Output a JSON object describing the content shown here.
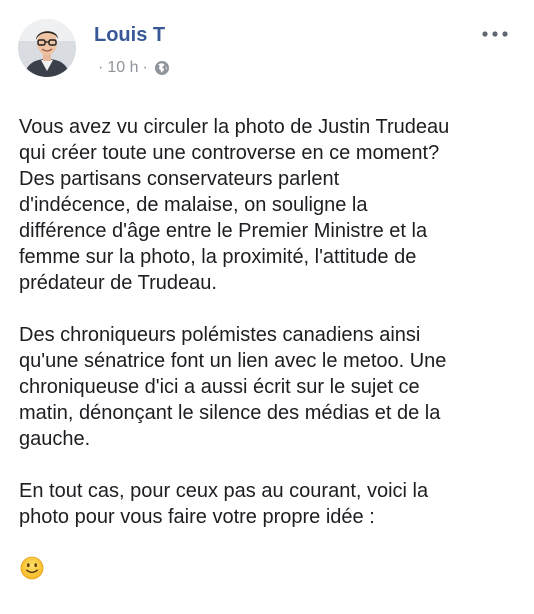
{
  "post": {
    "author": "Louis T",
    "time": "10 h",
    "separator": "·",
    "privacy_icon": "globe-icon",
    "more_icon": "more-options-icon",
    "paragraphs": [
      "Vous avez vu circuler la photo de Justin Trudeau\nqui créer toute une controverse en ce moment?\nDes partisans conservateurs parlent\nd'indécence, de malaise, on souligne la\ndifférence d'âge entre le Premier Ministre et la\nfemme sur la photo, la proximité, l'attitude de\nprédateur de Trudeau.",
      "Des chroniqueurs polémistes canadiens ainsi\nqu'une sénatrice font un lien avec le metoo. Une\nchroniqueuse d'ici a aussi écrit sur le sujet ce\nmatin, dénonçant le silence des médias et de la\ngauche.",
      "En tout cas, pour ceux pas au courant, voici la\nphoto pour vous faire votre propre idée :"
    ],
    "emoji": "slightly-smiling-face-icon"
  },
  "colors": {
    "author_link": "#385898",
    "meta_text": "#90949c",
    "body_text": "#1c1e21"
  }
}
